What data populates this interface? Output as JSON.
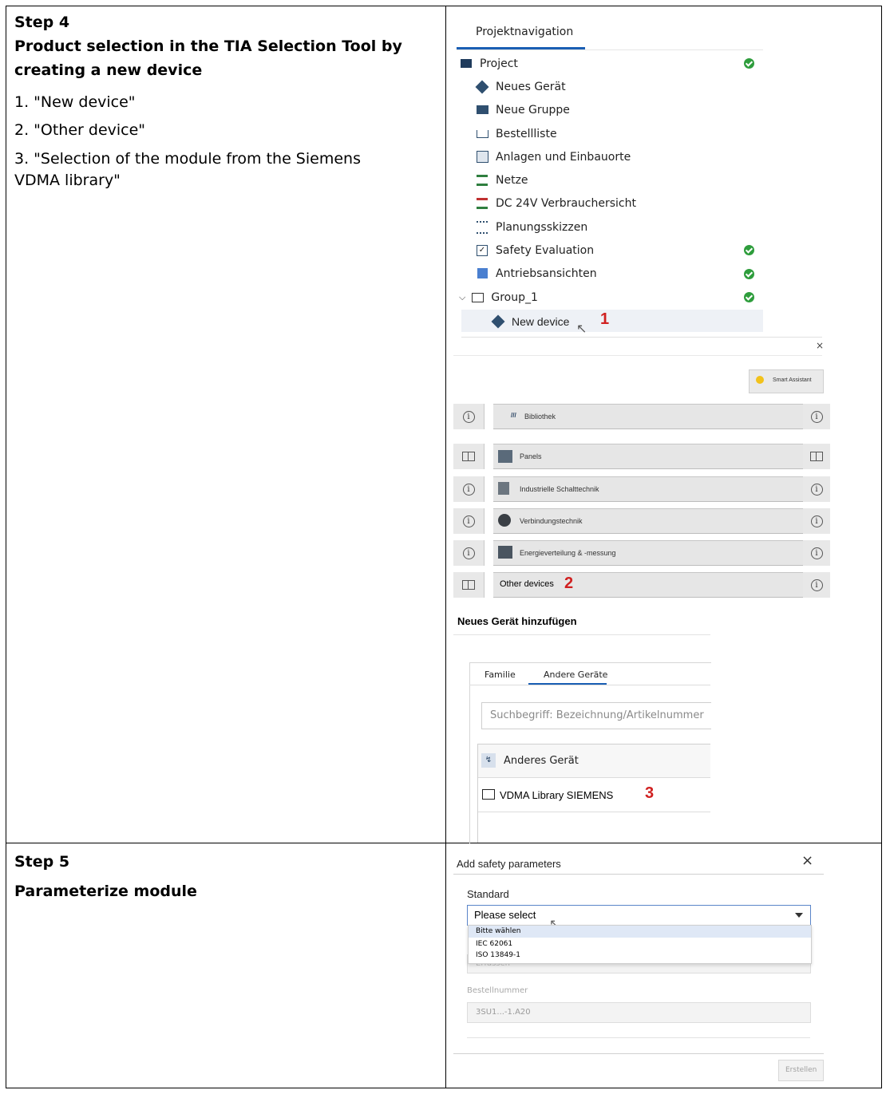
{
  "step4": {
    "title_line1": "Step 4",
    "title_line2": "Product selection in the TIA Selection Tool by",
    "title_line3": "creating a new device",
    "items": [
      "1. \"New device\"",
      "2. \"Other device\"",
      "3. \"Selection of the module from the Siemens",
      "VDMA library\""
    ]
  },
  "step5": {
    "title": "Step 5",
    "subtitle": "Parameterize module"
  },
  "nav": {
    "tab": "Projektnavigation",
    "project": "Project",
    "items": [
      "Neues Gerät",
      "Neue Gruppe",
      "Bestellliste",
      "Anlagen und Einbauorte",
      "Netze",
      "DC 24V Verbrauchersicht",
      "Planungsskizzen",
      "Safety Evaluation",
      "Antriebsansichten"
    ],
    "group": "Group_1",
    "new_device": "New device",
    "callout1": "1"
  },
  "library": {
    "close": "×",
    "smart_assistant": "Smart Assistant",
    "panels": [
      "Bibliothek",
      "Panels",
      "Industrielle Schalttechnik",
      "Verbindungstechnik",
      "Energieverteilung & -messung",
      "Other devices"
    ],
    "callout2": "2"
  },
  "add_device": {
    "title": "Neues Gerät hinzufügen",
    "tab_family": "Familie",
    "tab_other": "Andere Geräte",
    "search_placeholder": "Suchbegriff: Bezeichnung/Artikelnummer",
    "other_device": "Anderes Gerät",
    "vdma": "VDMA Library SIEMENS",
    "callout3": "3"
  },
  "dialog": {
    "title": "Add safety parameters",
    "close": "×",
    "standard_label": "Standard",
    "selected": "Please select",
    "options": [
      "Bitte wählen",
      "IEC 62061",
      "ISO 13849-1"
    ],
    "hidden_field_value": "Erfassen",
    "order_label": "Bestellnummer",
    "order_value": "3SU1...-1.A20",
    "create": "Erstellen"
  },
  "colors": {
    "accent": "#1a5fb4",
    "check": "#2e9d3c",
    "callout": "#d02020"
  }
}
